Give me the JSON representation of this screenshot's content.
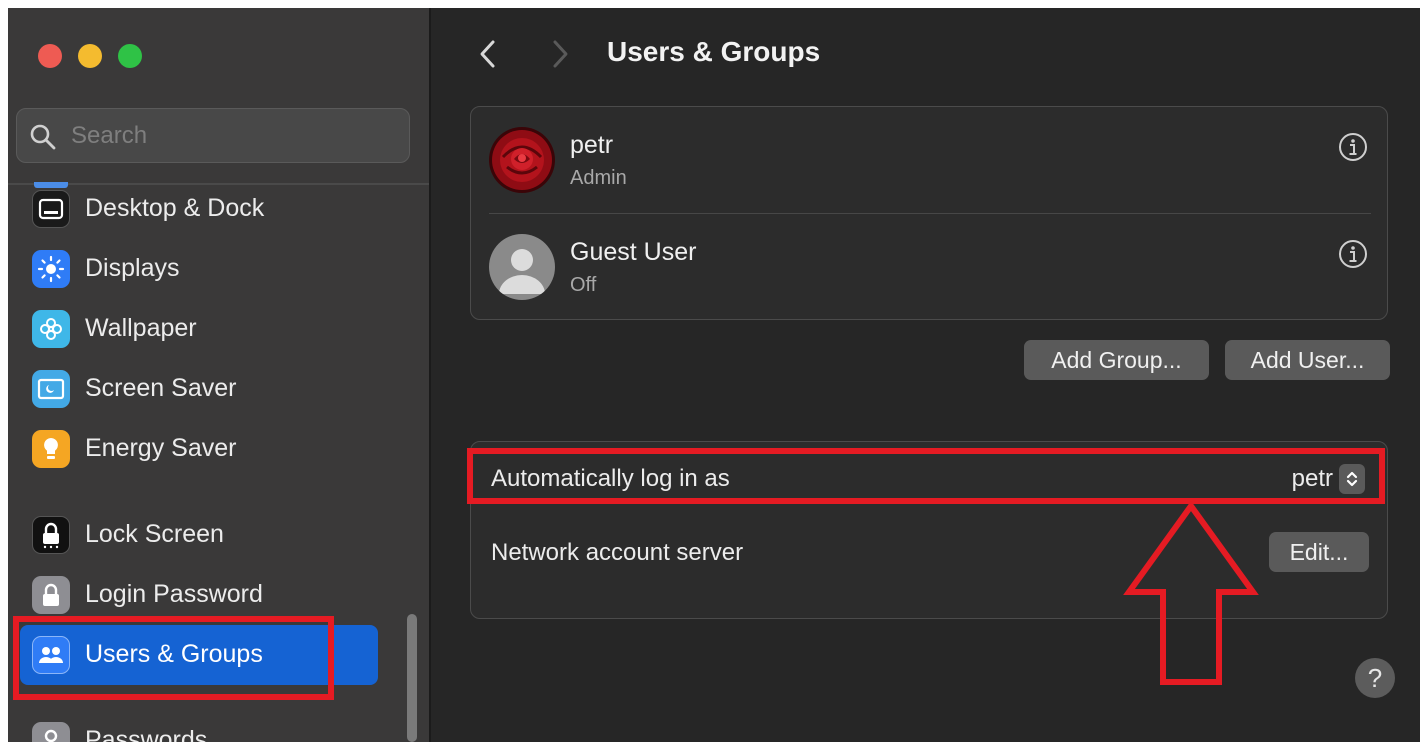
{
  "window": {
    "title": "Users & Groups"
  },
  "sidebar": {
    "search_placeholder": "Search",
    "items": [
      {
        "label": "Desktop & Dock",
        "icon": "desktop-dock-icon",
        "color": "#1a1a1a"
      },
      {
        "label": "Displays",
        "icon": "displays-icon",
        "color": "#2f7cf6"
      },
      {
        "label": "Wallpaper",
        "icon": "wallpaper-icon",
        "color": "#3fb7e8"
      },
      {
        "label": "Screen Saver",
        "icon": "screen-saver-icon",
        "color": "#43a9e6"
      },
      {
        "label": "Energy Saver",
        "icon": "energy-saver-icon",
        "color": "#f5a623"
      },
      {
        "label": "Lock Screen",
        "icon": "lock-screen-icon",
        "color": "#111111"
      },
      {
        "label": "Login Password",
        "icon": "login-password-icon",
        "color": "#8e8e93"
      },
      {
        "label": "Users & Groups",
        "icon": "users-groups-icon",
        "color": "#2f7cf6",
        "selected": true
      },
      {
        "label": "Passwords",
        "icon": "passwords-icon",
        "color": "#8e8e93"
      }
    ]
  },
  "users": [
    {
      "name": "petr",
      "role": "Admin"
    },
    {
      "name": "Guest User",
      "role": "Off"
    }
  ],
  "buttons": {
    "add_group": "Add Group...",
    "add_user": "Add User...",
    "edit": "Edit...",
    "help": "?"
  },
  "login": {
    "auto_login_label": "Automatically log in as",
    "auto_login_value": "petr",
    "network_label": "Network account server"
  },
  "colors": {
    "accent": "#1563d3",
    "annotation": "#e51b23"
  }
}
